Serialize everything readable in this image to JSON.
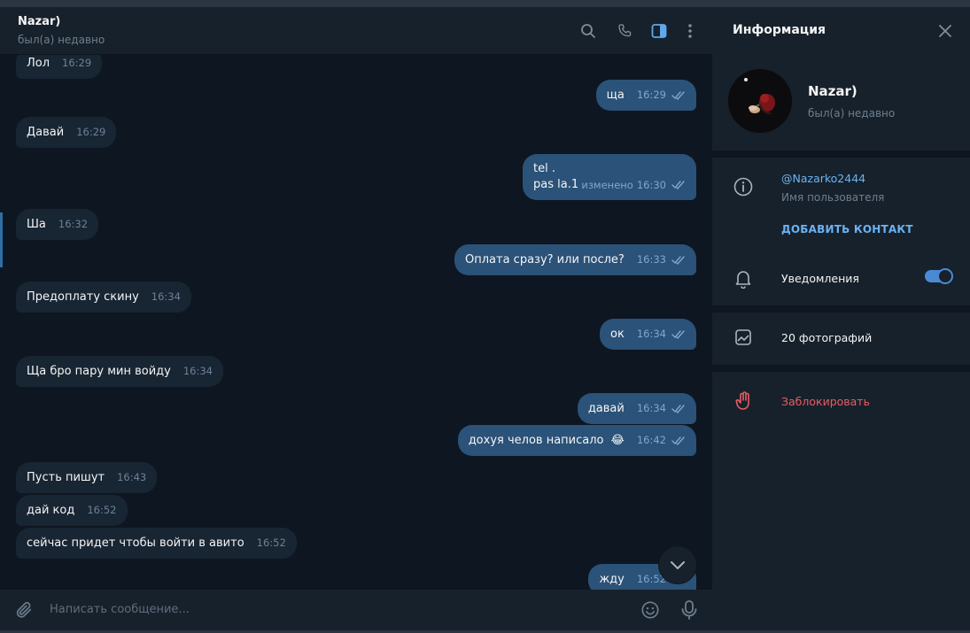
{
  "header": {
    "name": "Nazar)",
    "status": "был(а) недавно",
    "icons": [
      "search-icon",
      "phone-icon",
      "sidebar-toggle-icon",
      "more-vertical-icon"
    ]
  },
  "messages": [
    {
      "dir": "in",
      "text": "Лол",
      "time": "16:29"
    },
    {
      "dir": "out",
      "text": "ща",
      "time": "16:29"
    },
    {
      "dir": "in",
      "text": "Давай",
      "time": "16:29"
    },
    {
      "dir": "out",
      "line1": "tel .",
      "line2": "pas la.1",
      "edited": "изменено",
      "time": "16:30"
    },
    {
      "dir": "in",
      "text": "Ша",
      "time": "16:32"
    },
    {
      "dir": "out",
      "text": "Оплата сразу? или после?",
      "time": "16:33"
    },
    {
      "dir": "in",
      "text": "Предоплату скину",
      "time": "16:34"
    },
    {
      "dir": "out",
      "text": "ок",
      "time": "16:34"
    },
    {
      "dir": "in",
      "text": "Ща бро пару мин войду",
      "time": "16:34"
    },
    {
      "dir": "out",
      "text": "давай",
      "time": "16:34"
    },
    {
      "dir": "out",
      "text": "дохуя челов написало",
      "emoji": "😂",
      "time": "16:42"
    },
    {
      "dir": "in",
      "text": "Пусть пишут",
      "time": "16:43"
    },
    {
      "dir": "in",
      "text": "дай код",
      "time": "16:52"
    },
    {
      "dir": "in",
      "text": "сейчас придет чтобы войти в авито",
      "time": "16:52"
    },
    {
      "dir": "out",
      "text": "жду",
      "time": "16:52"
    }
  ],
  "composer": {
    "placeholder": "Написать сообщение..."
  },
  "info_panel": {
    "title": "Информация",
    "name": "Nazar)",
    "status": "был(а) недавно",
    "username": "@Nazarko2444",
    "username_label": "Имя пользователя",
    "add_contact": "ДОБАВИТЬ КОНТАКТ",
    "notifications": "Уведомления",
    "notifications_on": true,
    "photos": "20 фотографий",
    "block": "Заблокировать"
  },
  "colors": {
    "background": "#0e1621",
    "panel": "#17212b",
    "incoming_bubble": "#182533",
    "outgoing_bubble": "#2b5278",
    "accent": "#6ab3f3",
    "danger": "#e85d61"
  }
}
